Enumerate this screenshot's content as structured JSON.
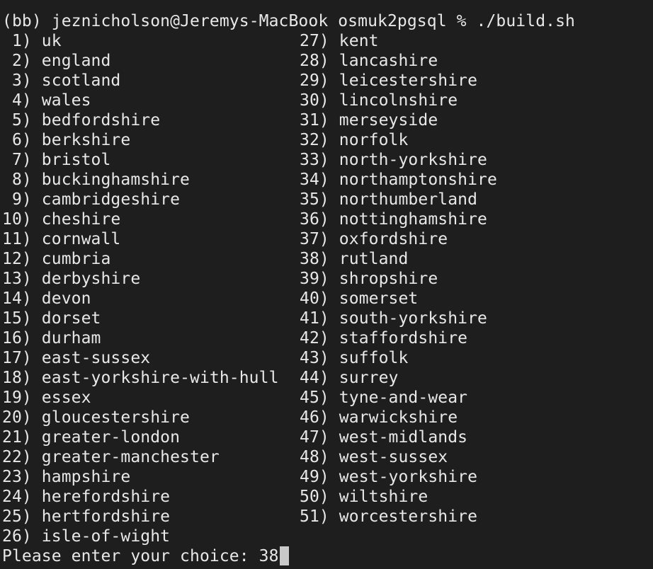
{
  "prompt": {
    "env": "(bb)",
    "user_host": "jeznicholson@Jeremys-MacBook",
    "cwd": "osmuk2pgsql",
    "symbol": "%",
    "command": "./build.sh"
  },
  "menu": {
    "left": [
      {
        "num": " 1)",
        "name": "uk"
      },
      {
        "num": " 2)",
        "name": "england"
      },
      {
        "num": " 3)",
        "name": "scotland"
      },
      {
        "num": " 4)",
        "name": "wales"
      },
      {
        "num": " 5)",
        "name": "bedfordshire"
      },
      {
        "num": " 6)",
        "name": "berkshire"
      },
      {
        "num": " 7)",
        "name": "bristol"
      },
      {
        "num": " 8)",
        "name": "buckinghamshire"
      },
      {
        "num": " 9)",
        "name": "cambridgeshire"
      },
      {
        "num": "10)",
        "name": "cheshire"
      },
      {
        "num": "11)",
        "name": "cornwall"
      },
      {
        "num": "12)",
        "name": "cumbria"
      },
      {
        "num": "13)",
        "name": "derbyshire"
      },
      {
        "num": "14)",
        "name": "devon"
      },
      {
        "num": "15)",
        "name": "dorset"
      },
      {
        "num": "16)",
        "name": "durham"
      },
      {
        "num": "17)",
        "name": "east-sussex"
      },
      {
        "num": "18)",
        "name": "east-yorkshire-with-hull"
      },
      {
        "num": "19)",
        "name": "essex"
      },
      {
        "num": "20)",
        "name": "gloucestershire"
      },
      {
        "num": "21)",
        "name": "greater-london"
      },
      {
        "num": "22)",
        "name": "greater-manchester"
      },
      {
        "num": "23)",
        "name": "hampshire"
      },
      {
        "num": "24)",
        "name": "herefordshire"
      },
      {
        "num": "25)",
        "name": "hertfordshire"
      },
      {
        "num": "26)",
        "name": "isle-of-wight"
      }
    ],
    "right": [
      {
        "num": "27)",
        "name": "kent"
      },
      {
        "num": "28)",
        "name": "lancashire"
      },
      {
        "num": "29)",
        "name": "leicestershire"
      },
      {
        "num": "30)",
        "name": "lincolnshire"
      },
      {
        "num": "31)",
        "name": "merseyside"
      },
      {
        "num": "32)",
        "name": "norfolk"
      },
      {
        "num": "33)",
        "name": "north-yorkshire"
      },
      {
        "num": "34)",
        "name": "northamptonshire"
      },
      {
        "num": "35)",
        "name": "northumberland"
      },
      {
        "num": "36)",
        "name": "nottinghamshire"
      },
      {
        "num": "37)",
        "name": "oxfordshire"
      },
      {
        "num": "38)",
        "name": "rutland"
      },
      {
        "num": "39)",
        "name": "shropshire"
      },
      {
        "num": "40)",
        "name": "somerset"
      },
      {
        "num": "41)",
        "name": "south-yorkshire"
      },
      {
        "num": "42)",
        "name": "staffordshire"
      },
      {
        "num": "43)",
        "name": "suffolk"
      },
      {
        "num": "44)",
        "name": "surrey"
      },
      {
        "num": "45)",
        "name": "tyne-and-wear"
      },
      {
        "num": "46)",
        "name": "warwickshire"
      },
      {
        "num": "47)",
        "name": "west-midlands"
      },
      {
        "num": "48)",
        "name": "west-sussex"
      },
      {
        "num": "49)",
        "name": "west-yorkshire"
      },
      {
        "num": "50)",
        "name": "wiltshire"
      },
      {
        "num": "51)",
        "name": "worcestershire"
      }
    ]
  },
  "input": {
    "label": "Please enter your choice:",
    "value": "38"
  },
  "colors": {
    "background": "#1e1e1e",
    "foreground": "#e8e8e8",
    "cursor": "#c9c9c9"
  }
}
